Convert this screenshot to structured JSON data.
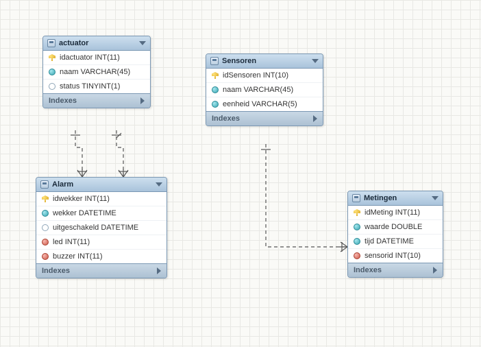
{
  "tables": {
    "actuator": {
      "title": "actuator",
      "columns": [
        {
          "icon": "key",
          "text": "idactuator INT(11)"
        },
        {
          "icon": "blue",
          "text": "naam VARCHAR(45)"
        },
        {
          "icon": "hollow",
          "text": "status TINYINT(1)"
        }
      ],
      "section": "Indexes"
    },
    "sensoren": {
      "title": "Sensoren",
      "columns": [
        {
          "icon": "key",
          "text": "idSensoren INT(10)"
        },
        {
          "icon": "blue",
          "text": "naam VARCHAR(45)"
        },
        {
          "icon": "blue",
          "text": "eenheid VARCHAR(5)"
        }
      ],
      "section": "Indexes"
    },
    "alarm": {
      "title": "Alarm",
      "columns": [
        {
          "icon": "key",
          "text": "idwekker INT(11)"
        },
        {
          "icon": "blue",
          "text": "wekker DATETIME"
        },
        {
          "icon": "hollow",
          "text": "uitgeschakeld DATETIME"
        },
        {
          "icon": "red",
          "text": "led INT(11)"
        },
        {
          "icon": "red",
          "text": "buzzer INT(11)"
        }
      ],
      "section": "Indexes"
    },
    "metingen": {
      "title": "Metingen",
      "columns": [
        {
          "icon": "key",
          "text": "idMeting INT(11)"
        },
        {
          "icon": "blue",
          "text": "waarde DOUBLE"
        },
        {
          "icon": "blue",
          "text": "tijd DATETIME"
        },
        {
          "icon": "red",
          "text": "sensorid INT(10)"
        }
      ],
      "section": "Indexes"
    }
  },
  "chart_data": {
    "type": "table",
    "description": "Entity-relationship diagram with 4 database tables",
    "entities": [
      {
        "name": "actuator",
        "columns": [
          "idactuator INT(11) PK",
          "naam VARCHAR(45)",
          "status TINYINT(1)"
        ]
      },
      {
        "name": "Sensoren",
        "columns": [
          "idSensoren INT(10) PK",
          "naam VARCHAR(45)",
          "eenheid VARCHAR(5)"
        ]
      },
      {
        "name": "Alarm",
        "columns": [
          "idwekker INT(11) PK",
          "wekker DATETIME",
          "uitgeschakeld DATETIME",
          "led INT(11) FK",
          "buzzer INT(11) FK"
        ]
      },
      {
        "name": "Metingen",
        "columns": [
          "idMeting INT(11) PK",
          "waarde DOUBLE",
          "tijd DATETIME",
          "sensorid INT(10) FK"
        ]
      }
    ],
    "relationships": [
      {
        "from": "Alarm.led",
        "to": "actuator.idactuator",
        "type": "many-to-one"
      },
      {
        "from": "Alarm.buzzer",
        "to": "actuator.idactuator",
        "type": "many-to-one"
      },
      {
        "from": "Metingen.sensorid",
        "to": "Sensoren.idSensoren",
        "type": "many-to-one"
      }
    ]
  }
}
